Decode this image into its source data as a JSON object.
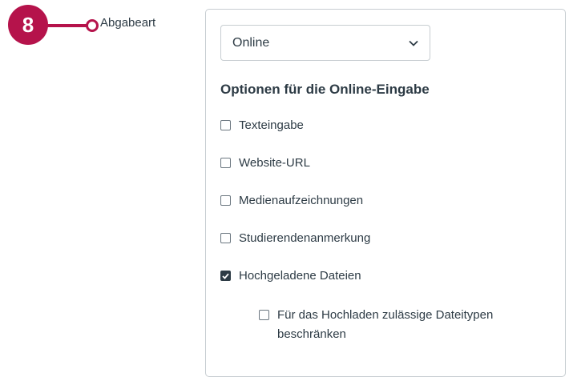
{
  "colors": {
    "accent": "#b5134b",
    "text": "#2d3b45",
    "border": "#c7cdd1"
  },
  "step_badge": {
    "number": "8"
  },
  "field": {
    "label": "Abgabeart"
  },
  "submission_type": {
    "selected": "Online",
    "icon": "chevron-down-icon"
  },
  "online_options": {
    "title": "Optionen für die Online-Eingabe",
    "items": [
      {
        "label": "Texteingabe",
        "checked": false
      },
      {
        "label": "Website-URL",
        "checked": false
      },
      {
        "label": "Medienaufzeichnungen",
        "checked": false
      },
      {
        "label": "Studierendenanmerkung",
        "checked": false
      },
      {
        "label": "Hochgeladene Dateien",
        "checked": true
      }
    ],
    "restrict_filetypes": {
      "label": "Für das Hochladen zulässige Dateitypen beschränken",
      "checked": false
    }
  }
}
